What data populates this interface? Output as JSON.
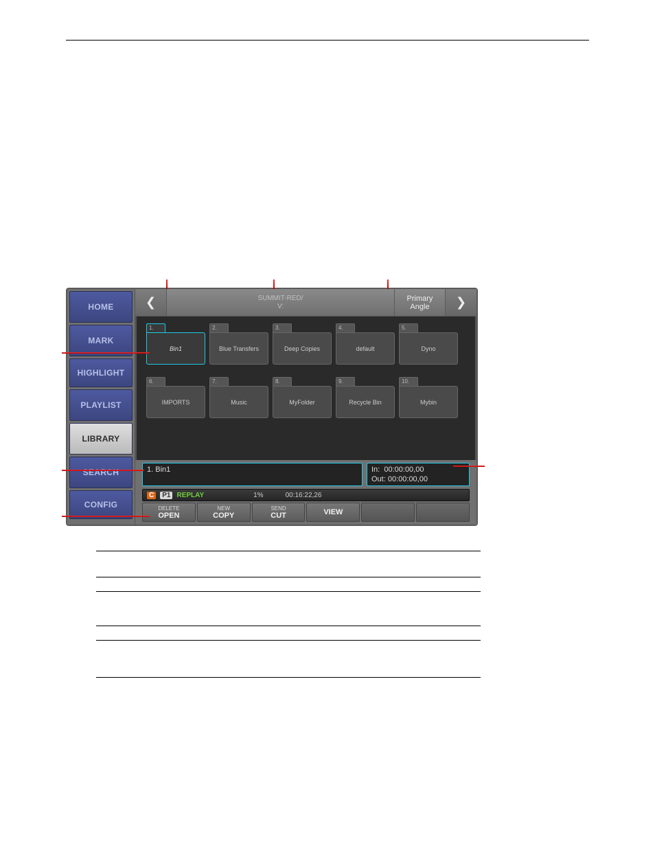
{
  "topbar": {
    "path_line1": "SUMMIT-RED/",
    "path_line2": "V:",
    "angle_line1": "Primary",
    "angle_line2": "Angle"
  },
  "sidebar": {
    "items": [
      {
        "label": "HOME"
      },
      {
        "label": "MARK"
      },
      {
        "label": "HIGHLIGHT"
      },
      {
        "label": "PLAYLIST"
      },
      {
        "label": "LIBRARY"
      },
      {
        "label": "SEARCH"
      },
      {
        "label": "CONFIG"
      }
    ]
  },
  "folders_row1": [
    {
      "num": "1.",
      "label": "Bin1",
      "selected": true
    },
    {
      "num": "2.",
      "label": "Blue Transfers"
    },
    {
      "num": "3.",
      "label": "Deep Copies"
    },
    {
      "num": "4.",
      "label": "default"
    },
    {
      "num": "5.",
      "label": "Dyno"
    }
  ],
  "folders_row2": [
    {
      "num": "6.",
      "label": "IMPORTS"
    },
    {
      "num": "7.",
      "label": "Music"
    },
    {
      "num": "8.",
      "label": "MyFolder"
    },
    {
      "num": "9.",
      "label": "Recycle Bin"
    },
    {
      "num": "10.",
      "label": "Mybin"
    }
  ],
  "info": {
    "selected_label": "1. Bin1",
    "in_label": "In:",
    "in_value": "00:00:00,00",
    "out_label": "Out:",
    "out_value": "00:00:00,00"
  },
  "replay": {
    "c": "C",
    "p": "P1",
    "label": "REPLAY",
    "percent": "1%",
    "time": "00:16:22,26"
  },
  "softkeys": [
    {
      "top": "DELETE",
      "bottom": "OPEN"
    },
    {
      "top": "NEW",
      "bottom": "COPY"
    },
    {
      "top": "SEND",
      "bottom": "CUT"
    },
    {
      "top": "",
      "bottom": "VIEW"
    },
    {
      "top": "",
      "bottom": ""
    },
    {
      "top": "",
      "bottom": ""
    }
  ],
  "table": {
    "headers": [
      "",
      "",
      ""
    ],
    "rows": [
      [
        "",
        "",
        ""
      ],
      [
        "",
        "",
        ""
      ],
      [
        "",
        "",
        ""
      ],
      [
        "",
        "",
        ""
      ]
    ]
  }
}
